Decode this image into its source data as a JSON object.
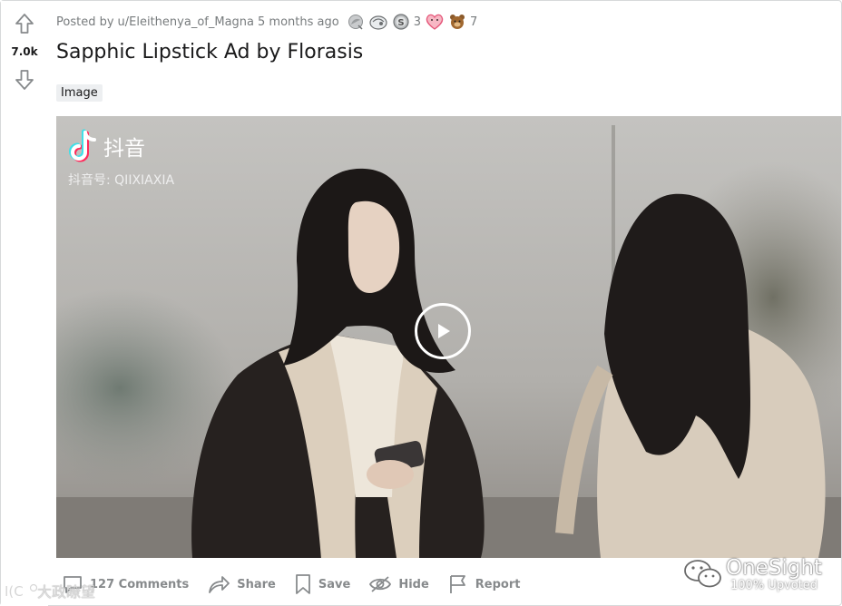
{
  "vote": {
    "count": "7.0k"
  },
  "meta": {
    "posted_prefix": "Posted by",
    "username": "u/Eleithenya_of_Magna",
    "time": "5 months ago",
    "awards": [
      {
        "icon": "silver-award-icon",
        "count": ""
      },
      {
        "icon": "helpful-award-icon",
        "count": ""
      },
      {
        "icon": "coin-award-icon",
        "count": "3"
      },
      {
        "icon": "heart-award-icon",
        "count": ""
      },
      {
        "icon": "bear-award-icon",
        "count": "7"
      }
    ]
  },
  "post": {
    "title": "Sapphic Lipstick Ad by Florasis",
    "flair": "Image"
  },
  "media": {
    "tiktok_name": "抖音",
    "tiktok_id": "抖音号: QIIXIAXIA",
    "play_icon": "play-icon"
  },
  "footer": {
    "comments_label": "127 Comments",
    "share_label": "Share",
    "save_label": "Save",
    "hide_label": "Hide",
    "report_label": "Report"
  },
  "watermarks": {
    "left_text": "大政瞭望",
    "brand": "OneSight",
    "subtitle": "100% Upvoted"
  },
  "colors": {
    "meta_text": "#787c7e",
    "action_text": "#878a8c",
    "flair_bg": "#edeff1"
  }
}
